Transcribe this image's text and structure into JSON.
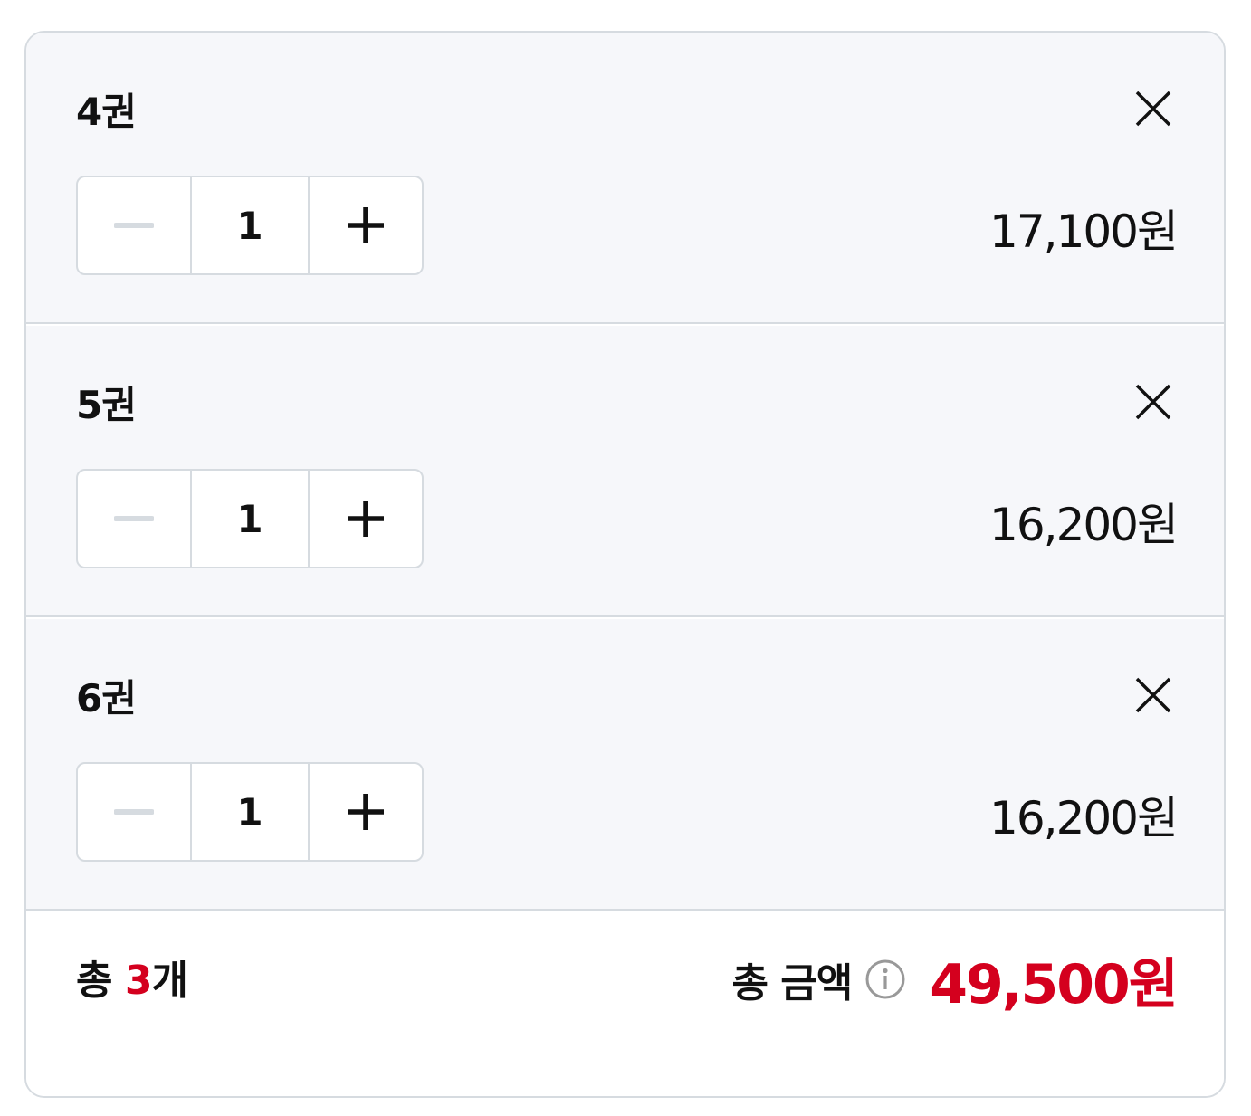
{
  "colors": {
    "accent_red": "#d4001e",
    "border": "#d6dbe0",
    "option_background": "#f6f7fa",
    "disabled_minus": "#d6dbe0"
  },
  "options": [
    {
      "title": "4권",
      "quantity": "1",
      "price": "17,100원",
      "remove_icon": "close-icon",
      "minus_icon": "minus-icon",
      "plus_icon": "plus-icon"
    },
    {
      "title": "5권",
      "quantity": "1",
      "price": "16,200원",
      "remove_icon": "close-icon",
      "minus_icon": "minus-icon",
      "plus_icon": "plus-icon"
    },
    {
      "title": "6권",
      "quantity": "1",
      "price": "16,200원",
      "remove_icon": "close-icon",
      "minus_icon": "minus-icon",
      "plus_icon": "plus-icon"
    }
  ],
  "summary": {
    "count_prefix": "총 ",
    "count_value": "3",
    "count_suffix": "개",
    "total_label": "총 금액",
    "info_icon": "info-icon",
    "total_price": "49,500원"
  }
}
